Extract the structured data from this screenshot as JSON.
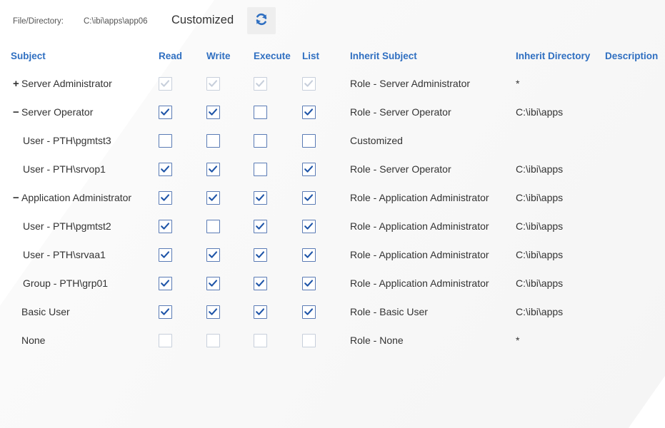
{
  "topbar": {
    "label": "File/Directory:",
    "path": "C:\\ibi\\apps\\app06",
    "state": "Customized",
    "refresh_icon": "refresh-icon"
  },
  "headers": {
    "subject": "Subject",
    "read": "Read",
    "write": "Write",
    "execute": "Execute",
    "list": "List",
    "inherit_subject": "Inherit Subject",
    "inherit_directory": "Inherit Directory",
    "description": "Description"
  },
  "colors": {
    "accent": "#2f6fc1",
    "check": "#1f55a8",
    "disabled": "#c7cfdb"
  },
  "rows": [
    {
      "sign": "+",
      "subject": "Server Administrator",
      "read": true,
      "write": true,
      "execute": true,
      "list": true,
      "disabled": true,
      "inherit_subject": "Role - Server Administrator",
      "inherit_directory": "*"
    },
    {
      "sign": "−",
      "subject": "Server Operator",
      "read": true,
      "write": true,
      "execute": false,
      "list": true,
      "disabled": false,
      "inherit_subject": "Role - Server Operator",
      "inherit_directory": "C:\\ibi\\apps"
    },
    {
      "sign": "",
      "subject": "User - PTH\\pgmtst3",
      "read": false,
      "write": false,
      "execute": false,
      "list": false,
      "disabled": false,
      "inherit_subject": "Customized",
      "inherit_directory": ""
    },
    {
      "sign": "",
      "subject": "User - PTH\\srvop1",
      "read": true,
      "write": true,
      "execute": false,
      "list": true,
      "disabled": false,
      "inherit_subject": "Role - Server Operator",
      "inherit_directory": "C:\\ibi\\apps"
    },
    {
      "sign": "−",
      "subject": "Application Administrator",
      "read": true,
      "write": true,
      "execute": true,
      "list": true,
      "disabled": false,
      "inherit_subject": "Role - Application Administrator",
      "inherit_directory": "C:\\ibi\\apps"
    },
    {
      "sign": "",
      "subject": "User - PTH\\pgmtst2",
      "read": true,
      "write": false,
      "execute": true,
      "list": true,
      "disabled": false,
      "inherit_subject": "Role - Application Administrator",
      "inherit_directory": "C:\\ibi\\apps"
    },
    {
      "sign": "",
      "subject": "User - PTH\\srvaa1",
      "read": true,
      "write": true,
      "execute": true,
      "list": true,
      "disabled": false,
      "inherit_subject": "Role - Application Administrator",
      "inherit_directory": "C:\\ibi\\apps"
    },
    {
      "sign": "",
      "subject": "Group - PTH\\grp01",
      "read": true,
      "write": true,
      "execute": true,
      "list": true,
      "disabled": false,
      "inherit_subject": "Role - Application Administrator",
      "inherit_directory": "C:\\ibi\\apps"
    },
    {
      "sign": "",
      "subject": "Basic User",
      "read": true,
      "write": true,
      "execute": true,
      "list": true,
      "disabled": false,
      "inherit_subject": "Role - Basic User",
      "inherit_directory": "C:\\ibi\\apps"
    },
    {
      "sign": "",
      "subject": "None",
      "read": false,
      "write": false,
      "execute": false,
      "list": false,
      "disabled": true,
      "inherit_subject": "Role - None",
      "inherit_directory": "*"
    }
  ]
}
